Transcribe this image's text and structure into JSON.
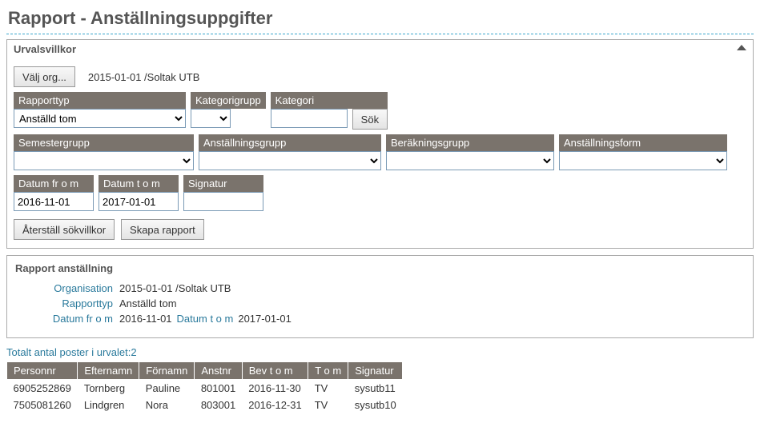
{
  "page_title": "Rapport - Anställningsuppgifter",
  "panel_heading": "Urvalsvillkor",
  "org_button": "Välj org...",
  "org_text": "2015-01-01 /Soltak UTB",
  "labels": {
    "rapporttyp": "Rapporttyp",
    "kategorigrupp": "Kategorigrupp",
    "kategori": "Kategori",
    "semestergrupp": "Semestergrupp",
    "anstallningsgrupp": "Anställningsgrupp",
    "berakningsgrupp": "Beräkningsgrupp",
    "anstallningsform": "Anställningsform",
    "datum_from": "Datum fr o m",
    "datum_tom": "Datum t o m",
    "signatur": "Signatur"
  },
  "values": {
    "rapporttyp_selected": "Anställd tom",
    "kategorigrupp_selected": "",
    "kategori_value": "",
    "semestergrupp_selected": "",
    "anstallningsgrupp_selected": "",
    "berakningsgrupp_selected": "",
    "anstallningsform_selected": "",
    "datum_from": "2016-11-01",
    "datum_tom": "2017-01-01",
    "signatur": ""
  },
  "buttons": {
    "sok": "Sök",
    "aterstall": "Återställ sökvillkor",
    "skapa": "Skapa rapport"
  },
  "report": {
    "title": "Rapport anställning",
    "organisation_label": "Organisation",
    "organisation_value": "2015-01-01 /Soltak UTB",
    "rapporttyp_label": "Rapporttyp",
    "rapporttyp_value": "Anställd tom",
    "datum_from_label": "Datum fr o m",
    "datum_from_value": "2016-11-01",
    "datum_tom_label": "Datum t o m",
    "datum_tom_value": "2017-01-01"
  },
  "total_line_prefix": "Totalt antal poster i urvalet:",
  "total_count": "2",
  "table": {
    "headers": [
      "Personnr",
      "Efternamn",
      "Förnamn",
      "Anstnr",
      "Bev t o m",
      "T o m",
      "Signatur"
    ],
    "rows": [
      [
        "6905252869",
        "Tornberg",
        "Pauline",
        "801001",
        "2016-11-30",
        "TV",
        "sysutb11"
      ],
      [
        "7505081260",
        "Lindgren",
        "Nora",
        "803001",
        "2016-12-31",
        "TV",
        "sysutb10"
      ]
    ]
  }
}
